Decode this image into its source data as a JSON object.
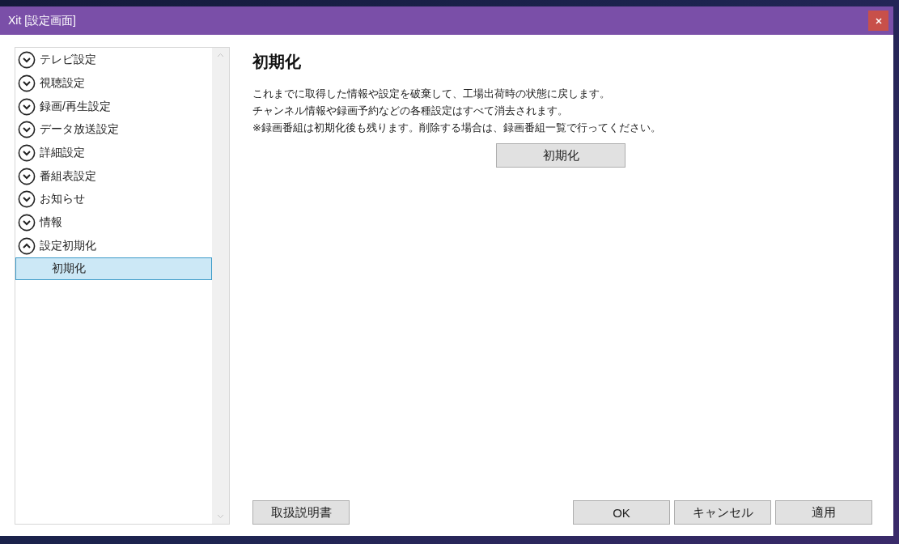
{
  "window": {
    "title": "Xit [設定画面]"
  },
  "sidebar": {
    "items": [
      {
        "label": "テレビ設定",
        "expanded": false
      },
      {
        "label": "視聴設定",
        "expanded": false
      },
      {
        "label": "録画/再生設定",
        "expanded": false
      },
      {
        "label": "データ放送設定",
        "expanded": false
      },
      {
        "label": "詳細設定",
        "expanded": false
      },
      {
        "label": "番組表設定",
        "expanded": false
      },
      {
        "label": "お知らせ",
        "expanded": false
      },
      {
        "label": "情報",
        "expanded": false
      },
      {
        "label": "設定初期化",
        "expanded": true,
        "children": [
          {
            "label": "初期化",
            "selected": true
          }
        ]
      }
    ]
  },
  "content": {
    "heading": "初期化",
    "lines": [
      "これまでに取得した情報や設定を破棄して、工場出荷時の状態に戻します。",
      "チャンネル情報や録画予約などの各種設定はすべて消去されます。",
      "※録画番組は初期化後も残ります。削除する場合は、録画番組一覧で行ってください。"
    ],
    "action_button": "初期化"
  },
  "footer": {
    "manual_button": "取扱説明書",
    "buttons": [
      "OK",
      "キャンセル",
      "適用"
    ]
  }
}
